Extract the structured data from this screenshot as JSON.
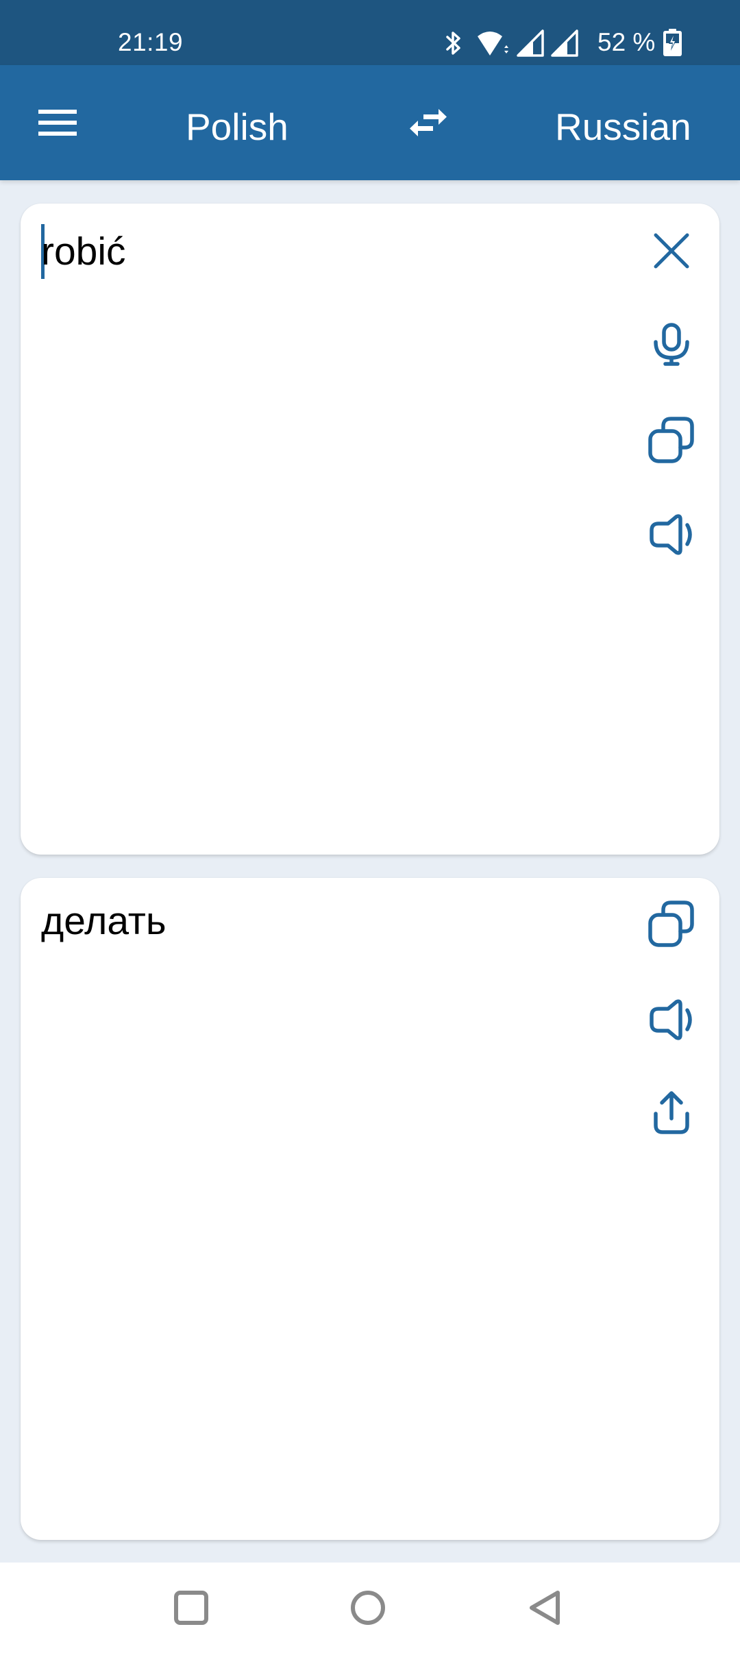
{
  "status_bar": {
    "time": "21:19",
    "battery_percent": "52 %",
    "icons": [
      "bluetooth-icon",
      "wifi-icon",
      "signal-icon",
      "signal-icon",
      "battery-charging-icon"
    ]
  },
  "header": {
    "menu_icon": "hamburger-menu-icon",
    "source_language": "Polish",
    "swap_icon": "swap-arrows-icon",
    "target_language": "Russian"
  },
  "source_card": {
    "input_value": "robić",
    "actions": [
      {
        "name": "clear",
        "icon": "close-icon"
      },
      {
        "name": "voice-input",
        "icon": "microphone-icon"
      },
      {
        "name": "copy",
        "icon": "copy-icon"
      },
      {
        "name": "speak",
        "icon": "speaker-icon"
      }
    ]
  },
  "target_card": {
    "translation": "делать",
    "actions": [
      {
        "name": "copy",
        "icon": "copy-icon"
      },
      {
        "name": "speak",
        "icon": "speaker-icon"
      },
      {
        "name": "share",
        "icon": "share-icon"
      }
    ]
  },
  "nav_bar": {
    "buttons": [
      "recents-square-icon",
      "home-circle-icon",
      "back-triangle-icon"
    ]
  },
  "colors": {
    "status_bar": "#1e5580",
    "header": "#2268a0",
    "accent_icon": "#2268a0",
    "background": "#e8eef5",
    "nav_icon": "#8a8a8a"
  }
}
